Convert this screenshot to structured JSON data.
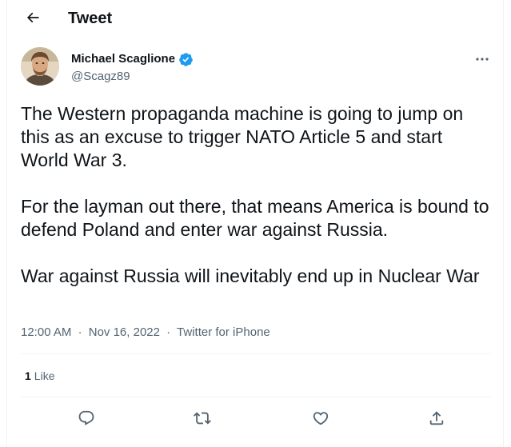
{
  "header": {
    "title": "Tweet"
  },
  "author": {
    "name": "Michael Scaglione",
    "handle": "@Scagz89",
    "verified": true
  },
  "tweet": {
    "paragraphs": [
      "The Western propaganda machine is going to jump on this as an excuse to trigger NATO Article 5 and start World War 3.",
      "For the layman out there, that means America is bound to defend Poland and enter war against Russia.",
      "War against Russia will inevitably end up in Nuclear War"
    ],
    "time": "12:00 AM",
    "date": "Nov 16, 2022",
    "source": "Twitter for iPhone",
    "separator": "·"
  },
  "stats": {
    "like_count": "1",
    "like_label": "Like"
  },
  "colors": {
    "text": "#0f1419",
    "secondary": "#536471",
    "verified": "#1d9bf0",
    "border": "#eff3f4"
  },
  "icons": {
    "back": "arrow-left-icon",
    "verified": "verified-badge-icon",
    "more": "more-icon",
    "reply": "reply-icon",
    "retweet": "retweet-icon",
    "like": "like-icon",
    "share": "share-icon"
  }
}
